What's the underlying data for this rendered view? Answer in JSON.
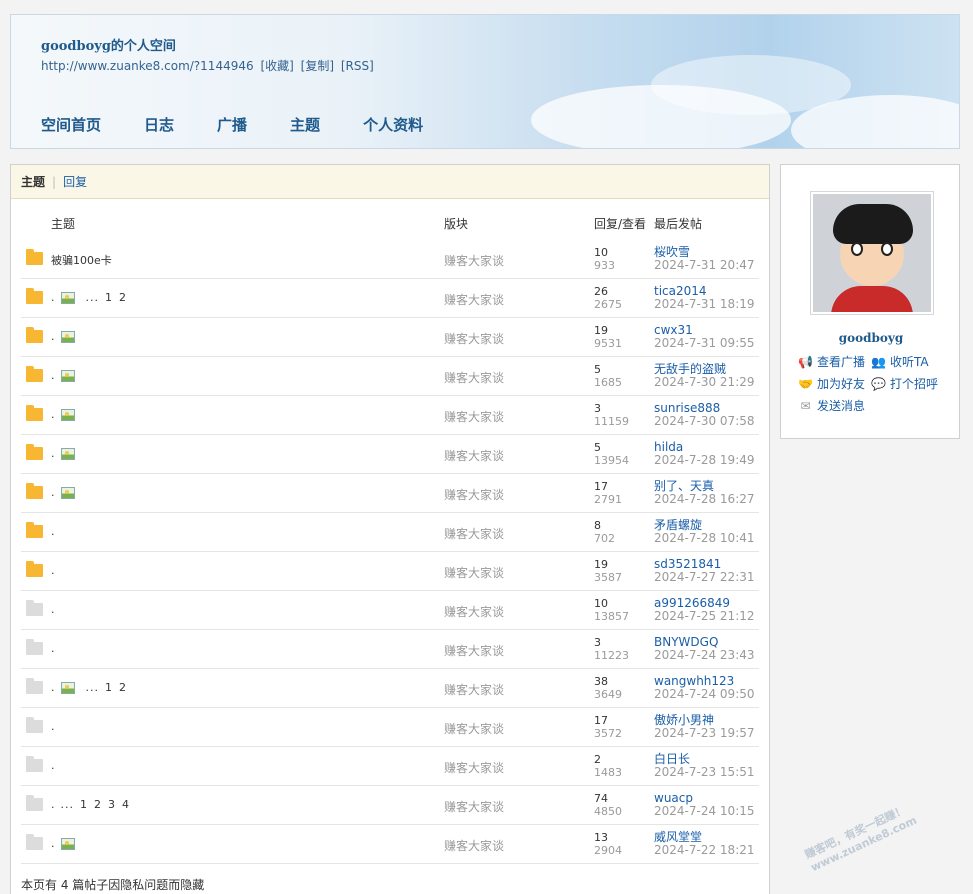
{
  "header": {
    "title": "goodboyg的个人空间",
    "url": "http://www.zuanke8.com/?1144946",
    "links": [
      "[收藏]",
      "[复制]",
      "[RSS]"
    ],
    "nav": [
      "空间首页",
      "日志",
      "广播",
      "主题",
      "个人资料"
    ]
  },
  "tabs": {
    "active": "主题",
    "other": "回复"
  },
  "table": {
    "headers": {
      "subject": "主题",
      "forum": "版块",
      "replies_views": "回复/查看",
      "lastpost": "最后发帖"
    },
    "rows": [
      {
        "icon": "hot",
        "title": "被骗100e卡",
        "img": false,
        "pages": [],
        "forum": "赚客大家谈",
        "replies": "10",
        "views": "933",
        "user": "桜吹雪",
        "date": "2024-7-31 20:47"
      },
      {
        "icon": "hot",
        "title": ".",
        "img": true,
        "pages": [
          "...",
          "1",
          "2"
        ],
        "forum": "赚客大家谈",
        "replies": "26",
        "views": "2675",
        "user": "tica2014",
        "date": "2024-7-31 18:19"
      },
      {
        "icon": "hot",
        "title": ".",
        "img": true,
        "pages": [],
        "forum": "赚客大家谈",
        "replies": "19",
        "views": "9531",
        "user": "cwx31",
        "date": "2024-7-31 09:55"
      },
      {
        "icon": "hot",
        "title": ".",
        "img": true,
        "pages": [],
        "forum": "赚客大家谈",
        "replies": "5",
        "views": "1685",
        "user": "无敌手的盗贼",
        "date": "2024-7-30 21:29"
      },
      {
        "icon": "hot",
        "title": ".",
        "img": true,
        "pages": [],
        "forum": "赚客大家谈",
        "replies": "3",
        "views": "11159",
        "user": "sunrise888",
        "date": "2024-7-30 07:58"
      },
      {
        "icon": "hot",
        "title": ".",
        "img": true,
        "pages": [],
        "forum": "赚客大家谈",
        "replies": "5",
        "views": "13954",
        "user": "hilda",
        "date": "2024-7-28 19:49"
      },
      {
        "icon": "hot",
        "title": ".",
        "img": true,
        "pages": [],
        "forum": "赚客大家谈",
        "replies": "17",
        "views": "2791",
        "user": "别了、天真",
        "date": "2024-7-28 16:27"
      },
      {
        "icon": "hot",
        "title": ".",
        "img": false,
        "pages": [],
        "forum": "赚客大家谈",
        "replies": "8",
        "views": "702",
        "user": "矛盾螺旋",
        "date": "2024-7-28 10:41"
      },
      {
        "icon": "hot",
        "title": ".",
        "img": false,
        "pages": [],
        "forum": "赚客大家谈",
        "replies": "19",
        "views": "3587",
        "user": "sd3521841",
        "date": "2024-7-27 22:31"
      },
      {
        "icon": "cold",
        "title": ".",
        "img": false,
        "pages": [],
        "forum": "赚客大家谈",
        "replies": "10",
        "views": "13857",
        "user": "a991266849",
        "date": "2024-7-25 21:12"
      },
      {
        "icon": "cold",
        "title": ".",
        "img": false,
        "pages": [],
        "forum": "赚客大家谈",
        "replies": "3",
        "views": "11223",
        "user": "BNYWDGQ",
        "date": "2024-7-24 23:43"
      },
      {
        "icon": "cold",
        "title": ".",
        "img": true,
        "pages": [
          "...",
          "1",
          "2"
        ],
        "forum": "赚客大家谈",
        "replies": "38",
        "views": "3649",
        "user": "wangwhh123",
        "date": "2024-7-24 09:50"
      },
      {
        "icon": "cold",
        "title": ".",
        "img": false,
        "pages": [],
        "forum": "赚客大家谈",
        "replies": "17",
        "views": "3572",
        "user": "傲娇小男神",
        "date": "2024-7-23 19:57"
      },
      {
        "icon": "cold",
        "title": ".",
        "img": false,
        "pages": [],
        "forum": "赚客大家谈",
        "replies": "2",
        "views": "1483",
        "user": "白日长",
        "date": "2024-7-23 15:51"
      },
      {
        "icon": "cold",
        "title": ".",
        "img": false,
        "pages": [
          "...",
          "1",
          "2",
          "3",
          "4"
        ],
        "forum": "赚客大家谈",
        "replies": "74",
        "views": "4850",
        "user": "wuacp",
        "date": "2024-7-24 10:15"
      },
      {
        "icon": "cold",
        "title": ".",
        "img": true,
        "pages": [],
        "forum": "赚客大家谈",
        "replies": "13",
        "views": "2904",
        "user": "威风堂堂",
        "date": "2024-7-22 18:21"
      }
    ],
    "hidden_note": "本页有 4 篇帖子因隐私问题而隐藏"
  },
  "profile": {
    "username": "goodboyg",
    "actions": [
      "查看广播",
      "收听TA",
      "加为好友",
      "打个招呼",
      "发送消息"
    ]
  },
  "watermark": "赚客吧，有奖一起赚！ www.zuanke8.com"
}
